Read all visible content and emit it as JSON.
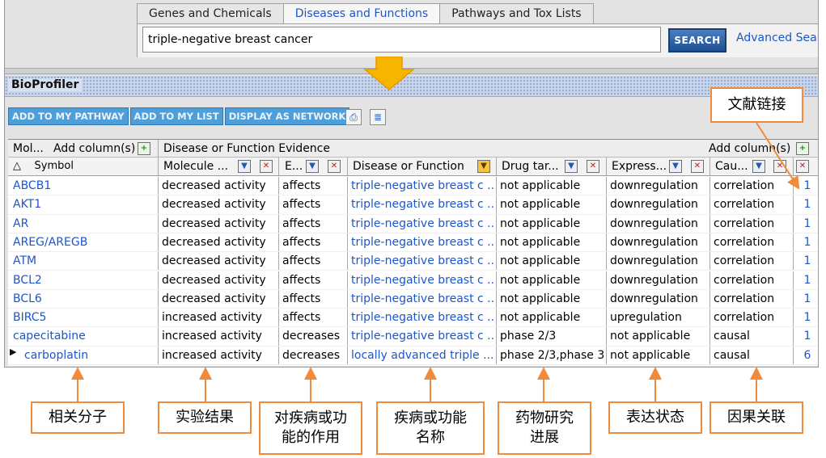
{
  "tabs": [
    "Genes and Chemicals",
    "Diseases and Functions",
    "Pathways and Tox Lists"
  ],
  "active_tab": 1,
  "search": {
    "value": "triple-negative breast cancer",
    "button": "SEARCH",
    "advanced": "Advanced Search"
  },
  "section_title": "BioProfiler",
  "toolbar": {
    "buttons": [
      "ADD TO MY PATHWAY",
      "ADD TO MY LIST",
      "DISPLAY AS NETWORK"
    ]
  },
  "table": {
    "group_left": "Mol...",
    "add_columns": "Add column(s)",
    "group_right": "Disease or Function Evidence",
    "headers": [
      "Symbol",
      "Molecule ...",
      "E...",
      "Disease or Function",
      "Drug tar...",
      "Express...",
      "Cau..."
    ],
    "rows": [
      [
        "ABCB1",
        "decreased activity",
        "affects",
        "triple-negative breast c ...",
        "not applicable",
        "downregulation",
        "correlation",
        "1"
      ],
      [
        "AKT1",
        "decreased activity",
        "affects",
        "triple-negative breast c ...",
        "not applicable",
        "downregulation",
        "correlation",
        "1"
      ],
      [
        "AR",
        "decreased activity",
        "affects",
        "triple-negative breast c ...",
        "not applicable",
        "downregulation",
        "correlation",
        "1"
      ],
      [
        "AREG/AREGB",
        "decreased activity",
        "affects",
        "triple-negative breast c ...",
        "not applicable",
        "downregulation",
        "correlation",
        "1"
      ],
      [
        "ATM",
        "decreased activity",
        "affects",
        "triple-negative breast c ...",
        "not applicable",
        "downregulation",
        "correlation",
        "1"
      ],
      [
        "BCL2",
        "decreased activity",
        "affects",
        "triple-negative breast c ...",
        "not applicable",
        "downregulation",
        "correlation",
        "1"
      ],
      [
        "BCL6",
        "decreased activity",
        "affects",
        "triple-negative breast c ...",
        "not applicable",
        "downregulation",
        "correlation",
        "1"
      ],
      [
        "BIRC5",
        "increased activity",
        "affects",
        "triple-negative breast c ...",
        "not applicable",
        "upregulation",
        "correlation",
        "1"
      ],
      [
        "capecitabine",
        "increased activity",
        "decreases",
        "triple-negative breast c ...",
        "phase 2/3",
        "not applicable",
        "causal",
        "1"
      ],
      [
        "carboplatin",
        "increased activity",
        "decreases",
        "locally advanced triple ...",
        "phase 2/3,phase 3",
        "not applicable",
        "causal",
        "6"
      ]
    ]
  },
  "annotations": {
    "literature_link": "文献链接",
    "related_molecule": "相关分子",
    "experimental_result": "实验结果",
    "effect_on_disease": "对疾病或功能的作用",
    "disease_name": "疾病或功能名称",
    "drug_progress": "药物研究进展",
    "expression_state": "表达状态",
    "causality": "因果关联"
  },
  "colors": {
    "accent": "#1d56c9",
    "annotation_border": "#f08a3c",
    "arrow": "#f7b500",
    "toolbar_button": "#4d9ed9"
  }
}
